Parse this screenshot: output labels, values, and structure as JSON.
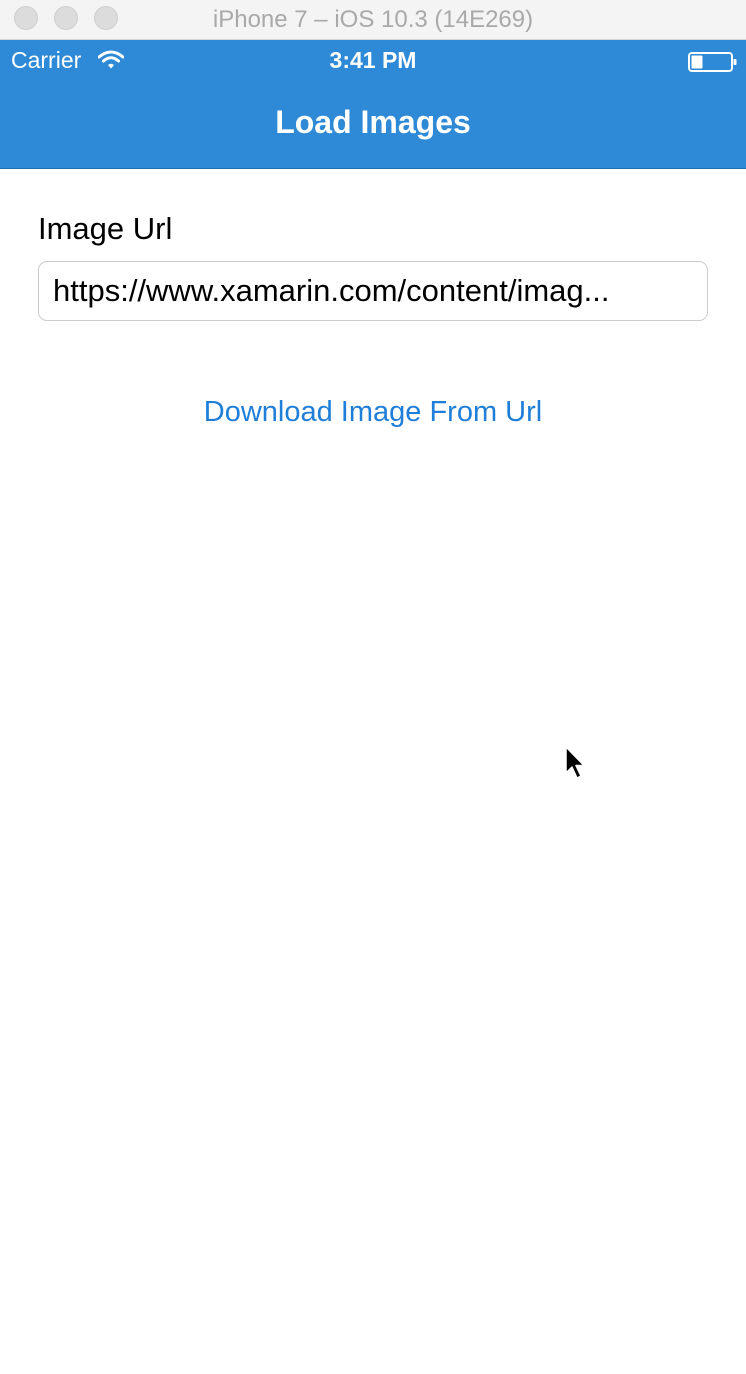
{
  "window": {
    "title": "iPhone 7 – iOS 10.3 (14E269)"
  },
  "status_bar": {
    "carrier": "Carrier",
    "time": "3:41 PM",
    "icons": [
      "wifi-icon",
      "battery-icon"
    ]
  },
  "nav": {
    "title": "Load Images",
    "background_color": "#2e8ad6"
  },
  "form": {
    "label": "Image Url",
    "url_value": "https://www.xamarin.com/content/imag..."
  },
  "actions": {
    "download_label": "Download Image From Url",
    "link_color": "#1f7fd8"
  }
}
